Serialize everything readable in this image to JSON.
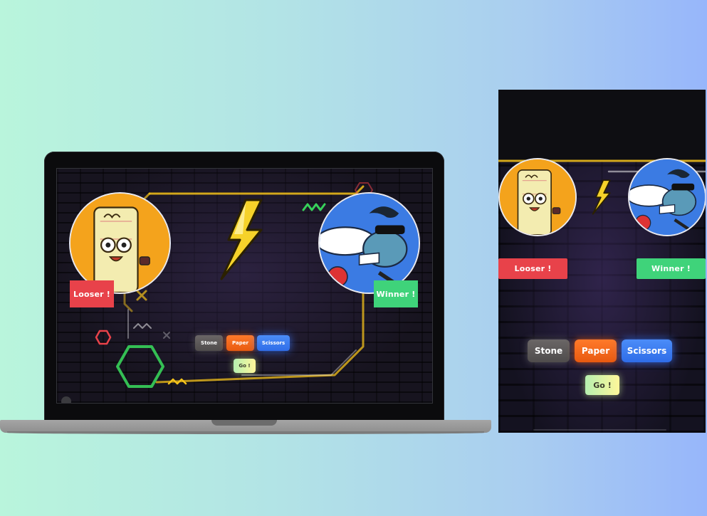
{
  "desktop": {
    "loser_label": "Looser !",
    "winner_label": "Winner !",
    "buttons": {
      "stone": "Stone",
      "paper": "Paper",
      "scissors": "Scissors",
      "go": "Go !"
    }
  },
  "mobile": {
    "loser_label": "Looser !",
    "winner_label": "Winner !",
    "buttons": {
      "stone": "Stone",
      "paper": "Paper",
      "scissors": "Scissors",
      "go": "Go !"
    }
  },
  "icons": {
    "lightning": "lightning-icon",
    "paper_character": "paper-character-avatar",
    "mosquito_character": "mosquito-character-avatar"
  },
  "colors": {
    "loser": "#e8424a",
    "winner": "#3fd37a",
    "stone": "#5c5959",
    "paper": "#f26a1d",
    "scissors": "#3a7cf2",
    "go": "#d9f6a4",
    "neon_yellow": "#f4c21b",
    "neon_green": "#37d15a"
  }
}
